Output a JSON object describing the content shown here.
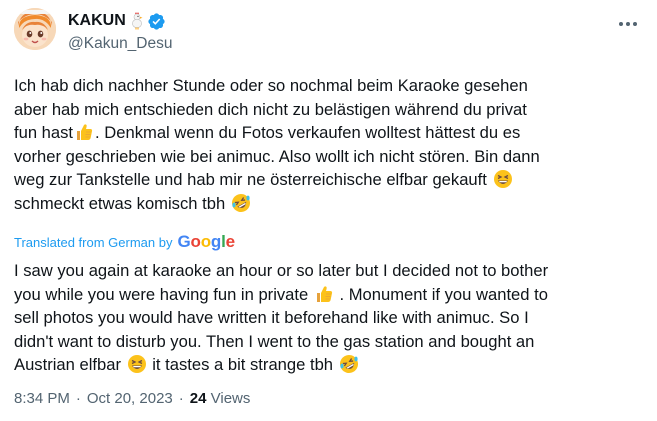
{
  "author": {
    "display_name": "KAKUN",
    "name_emoji": "chicken-emoji",
    "verified": true,
    "handle": "@Kakun_Desu"
  },
  "icons": {
    "more": "more-icon",
    "verified": "verified-badge-icon",
    "thumbs_up": "thumbs-up-emoji",
    "grinning_squint": "grinning-squinting-emoji",
    "rofl": "rolling-on-floor-laughing-emoji"
  },
  "original": {
    "lines": [
      "Ich hab dich nachher Stunde oder so nochmal beim Karaoke gesehen",
      "aber hab mich entschieden dich nicht zu belästigen während du privat",
      "fun hast",
      ". Denkmal wenn du Fotos verkaufen wolltest hättest du es",
      "vorher geschrieben wie bei animuc. Also wollt ich nicht stören. Bin dann",
      "weg zur Tankstelle und hab mir ne österreichische elfbar gekauft",
      "schmeckt etwas komisch tbh"
    ]
  },
  "translation_label": "Translated from German by",
  "translation_provider": "Google",
  "translation": {
    "lines": [
      "I saw you again at karaoke an hour or so later but I decided not to bother",
      "you while you were having fun in private",
      ". Monument if you wanted to",
      "sell photos you would have written it beforehand like with animuc. So I",
      "didn't want to disturb you. Then I went to the gas station and bought an",
      "Austrian elfbar",
      "it tastes a bit strange tbh"
    ]
  },
  "meta": {
    "time": "8:34 PM",
    "separator": "·",
    "date": "Oct 20, 2023",
    "views_count": "24",
    "views_label": "Views"
  },
  "colors": {
    "text": "#0f1419",
    "secondary": "#536471",
    "link": "#1d9bf0",
    "verified": "#1d9bf0"
  }
}
